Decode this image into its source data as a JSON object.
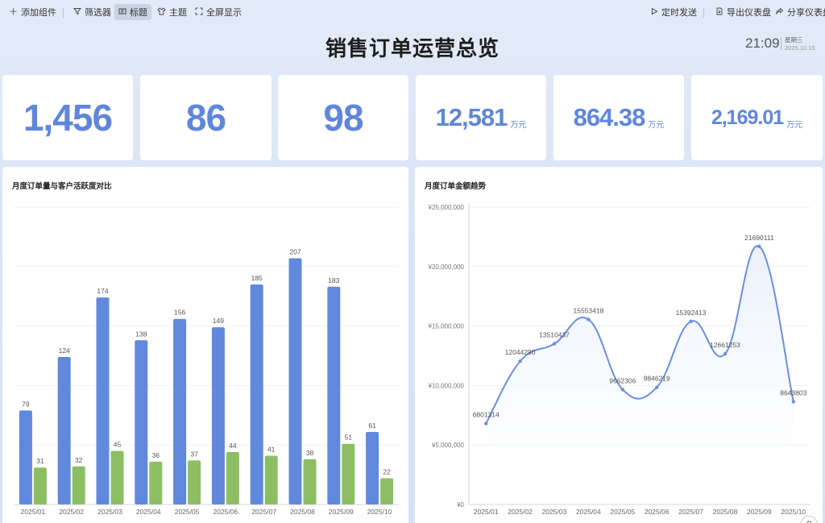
{
  "toolbar": {
    "add_widget": "添加组件",
    "filter": "筛选器",
    "title": "标题",
    "theme": "主题",
    "fullscreen": "全屏显示",
    "schedule_send": "定时发送",
    "export": "导出仪表盘",
    "share": "分享仪表盘"
  },
  "header": {
    "title": "销售订单运营总览",
    "time": "21:09",
    "weekday": "星期三",
    "date": "2025.10.15"
  },
  "kpis": [
    {
      "value": "1,456",
      "unit": ""
    },
    {
      "value": "86",
      "unit": ""
    },
    {
      "value": "98",
      "unit": ""
    },
    {
      "value": "12,581",
      "unit": "万元"
    },
    {
      "value": "864.38",
      "unit": "万元"
    },
    {
      "value": "2,169.01",
      "unit": "万元"
    }
  ],
  "colors": {
    "accent": "#5f86db",
    "bar_blue": "#6088dc",
    "bar_green": "#8cbe64",
    "line": "#6a8fdc"
  },
  "chart_data": [
    {
      "type": "bar",
      "title": "月度订单量与客户活跃度对比",
      "categories": [
        "2025/01",
        "2025/02",
        "2025/03",
        "2025/04",
        "2025/05",
        "2025/06",
        "2025/07",
        "2025/08",
        "2025/09",
        "2025/10"
      ],
      "series": [
        {
          "values": [
            79,
            124,
            174,
            138,
            156,
            149,
            185,
            207,
            183,
            61
          ]
        },
        {
          "values": [
            31,
            32,
            45,
            36,
            37,
            44,
            41,
            38,
            51,
            22
          ]
        }
      ],
      "ylim": [
        0,
        250
      ],
      "grid": true,
      "legend": "none"
    },
    {
      "type": "area",
      "title": "月度订单金额趋势",
      "categories": [
        "2025/01",
        "2025/02",
        "2025/03",
        "2025/04",
        "2025/05",
        "2025/06",
        "2025/07",
        "2025/08",
        "2025/09",
        "2025/10"
      ],
      "series": [
        {
          "values": [
            6801314,
            12044290,
            13510437,
            15553418,
            9662306,
            9846219,
            15392413,
            12661253,
            21690111,
            8643803
          ]
        }
      ],
      "yticks": [
        "¥0",
        "¥5,000,000",
        "¥10,000,000",
        "¥15,000,000",
        "¥20,000,000",
        "¥25,000,000"
      ],
      "ylim": [
        0,
        25000000
      ],
      "grid": true,
      "smooth": true
    }
  ]
}
